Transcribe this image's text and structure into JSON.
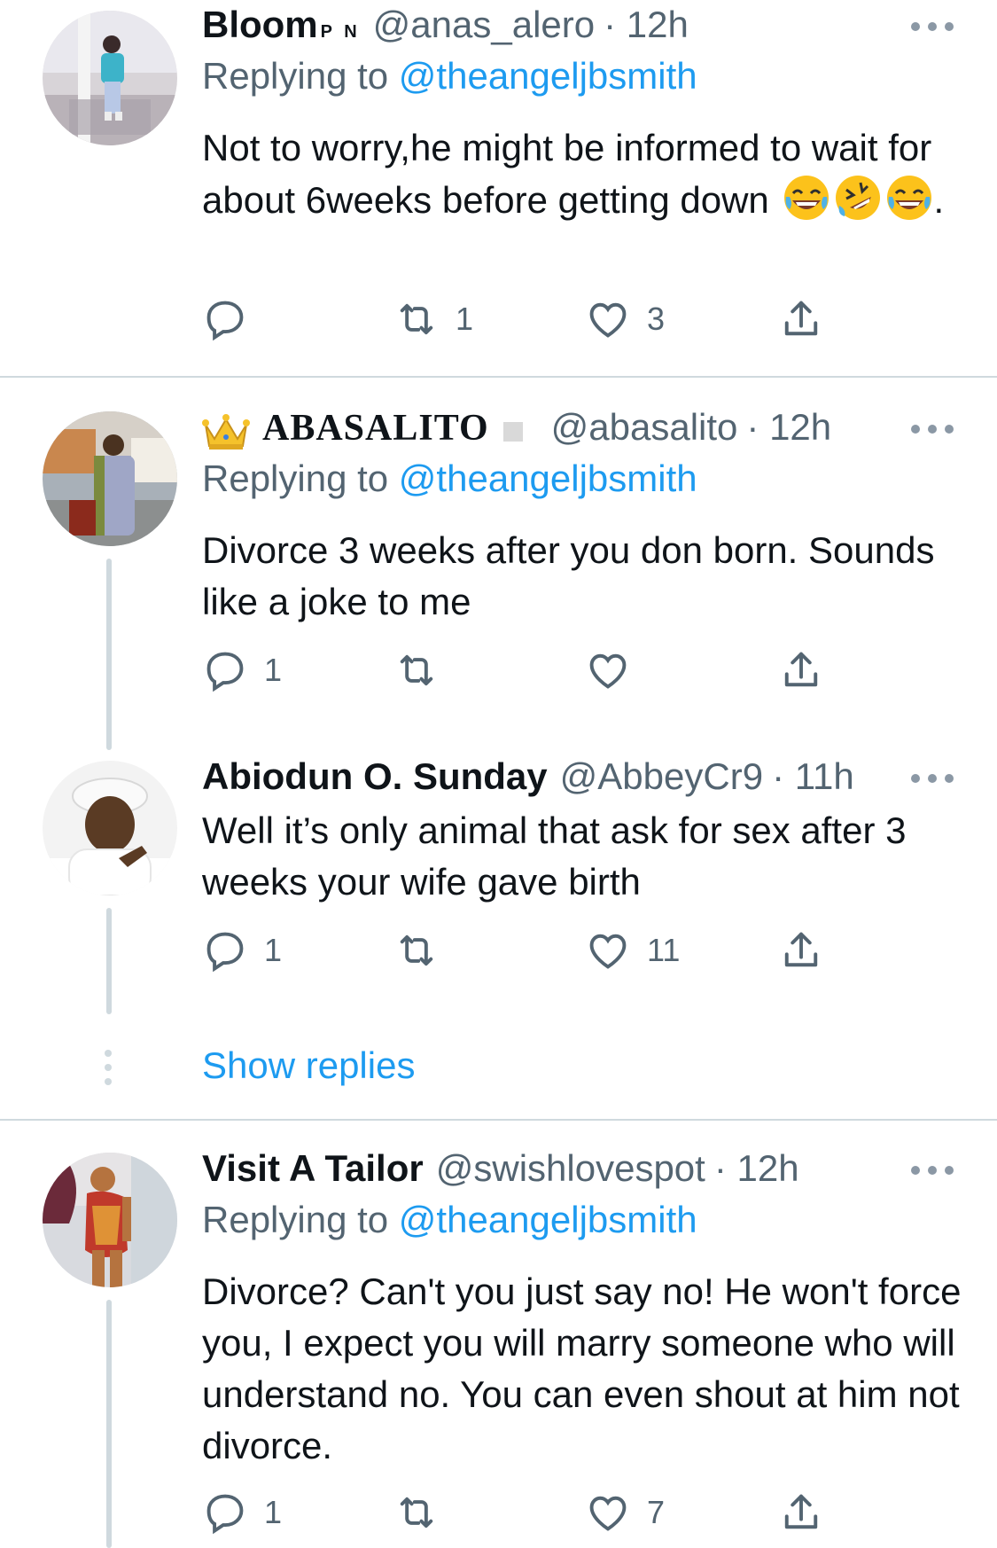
{
  "tweets": [
    {
      "name": "Bloom",
      "name_sup": "P N",
      "handle": "@anas_alero",
      "time": "· 12h",
      "replying_label": "Replying to",
      "replying_to": "@theangeljbsmith",
      "text": "Not to worry,he might be informed to wait for about 6weeks before getting down",
      "emojis": [
        "face-with-tears-of-joy",
        "rolling-on-floor-laughing",
        "face-with-tears-of-joy"
      ],
      "text_suffix": ".",
      "replies": "",
      "retweets": "1",
      "likes": "3"
    },
    {
      "name": "ABASALITO",
      "handle": "@abasalito",
      "time": "· 12h",
      "replying_label": "Replying to",
      "replying_to": "@theangeljbsmith",
      "text": "Divorce 3 weeks after you don born. Sounds like a joke to me",
      "replies": "1",
      "retweets": "",
      "likes": ""
    },
    {
      "name": "Abiodun O. Sunday",
      "handle": "@AbbeyCr9",
      "time": "· 11h",
      "text": "Well it’s only animal that ask for sex after 3 weeks your wife gave birth",
      "replies": "1",
      "retweets": "",
      "likes": "11"
    },
    {
      "name": "Visit A Tailor",
      "handle": "@swishlovespot",
      "time": "· 12h",
      "replying_label": "Replying to",
      "replying_to": "@theangeljbsmith",
      "text": "Divorce? Can't you just say no! He won't force you, I expect you will marry someone who will understand no. You can even shout at him not divorce.",
      "replies": "1",
      "retweets": "",
      "likes": "7"
    }
  ],
  "show_replies_label": "Show replies",
  "colors": {
    "link": "#1d9bf0",
    "secondary_text": "#536471",
    "divider": "#cfd9de",
    "text": "#0f1419"
  },
  "icons": [
    "reply-icon",
    "retweet-icon",
    "like-icon",
    "share-icon",
    "more-icon",
    "crown-icon"
  ]
}
